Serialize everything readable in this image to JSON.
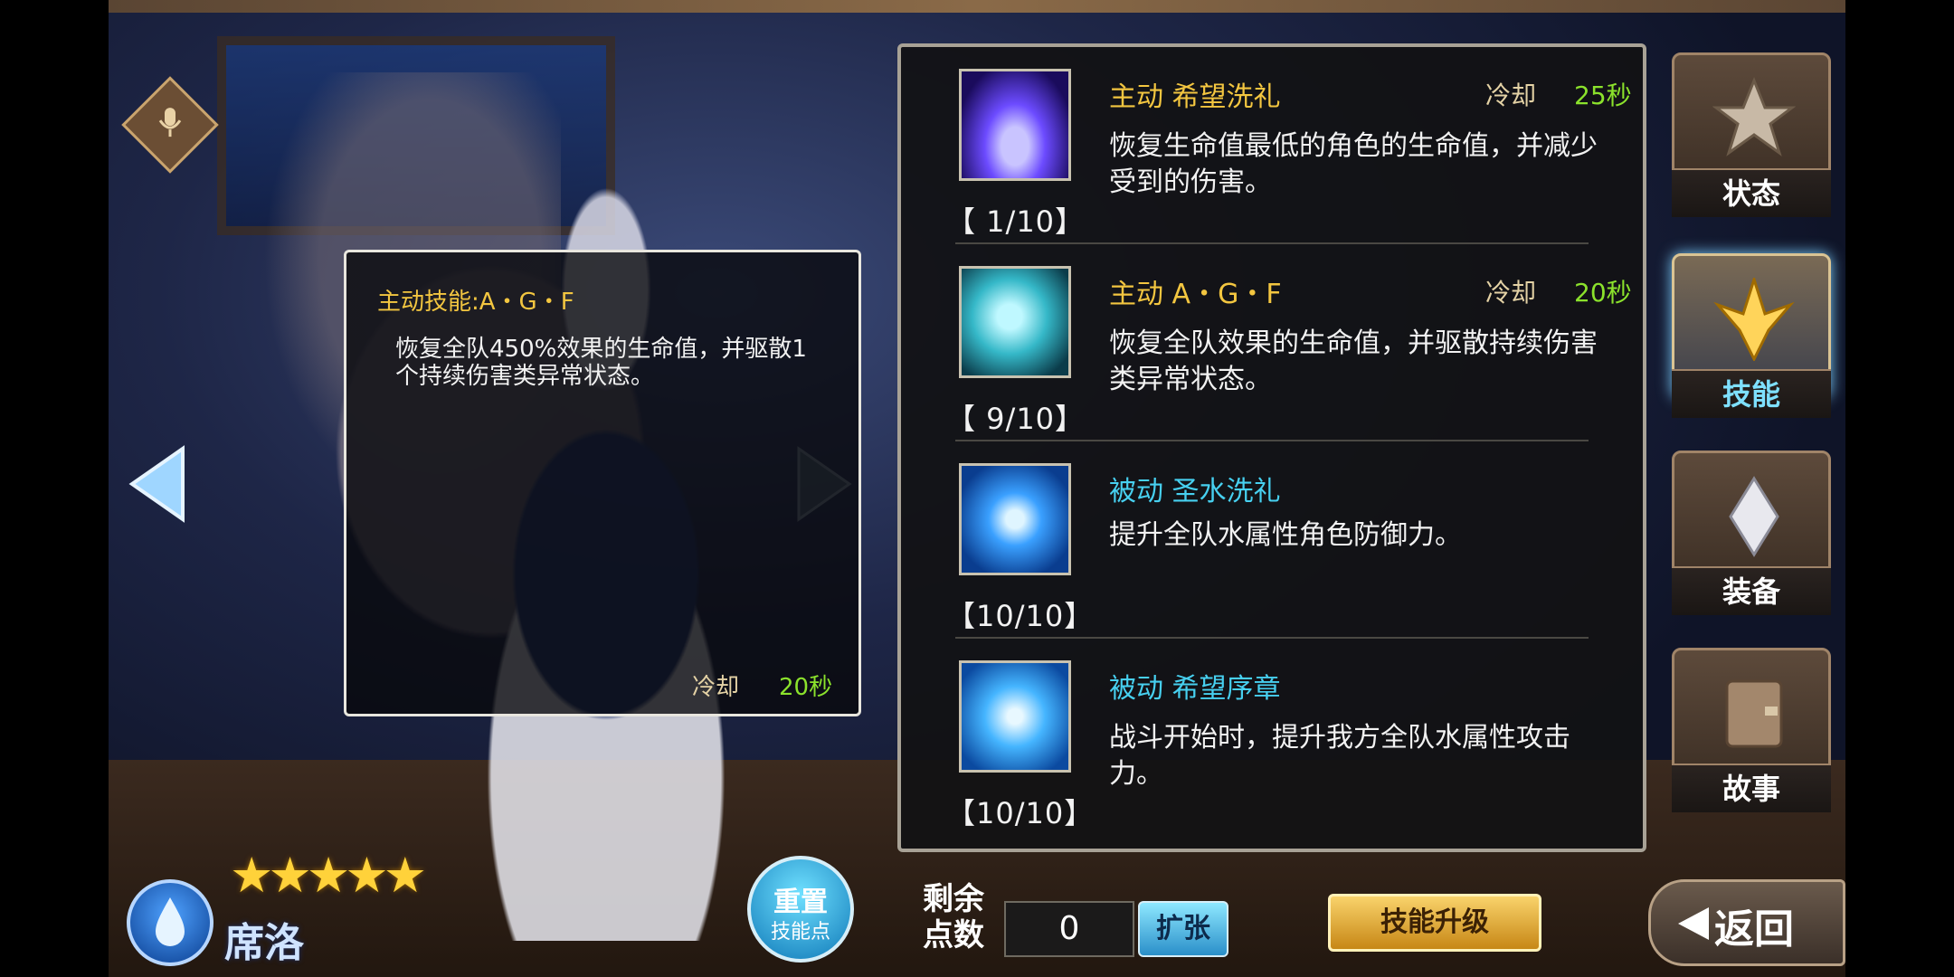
{
  "tooltip": {
    "title": "主动技能:A・G・F",
    "description": "恢复全队450%效果的生命值，并驱散1个持续伤害类异常状态。",
    "cooldown_label": "冷却",
    "cooldown_value": "20秒"
  },
  "skills": [
    {
      "type": "主动",
      "name": "希望洗礼",
      "kind": "active",
      "cooldown_label": "冷却",
      "cooldown_value": "25秒",
      "description": "恢复生命值最低的角色的生命值，并减少受到的伤害。",
      "level": "【  1/10】",
      "icon": "hope-baptism-icon"
    },
    {
      "type": "主动",
      "name": "A・G・F",
      "kind": "active",
      "cooldown_label": "冷却",
      "cooldown_value": "20秒",
      "description": "恢复全队效果的生命值，并驱散持续伤害类异常状态。",
      "level": "【  9/10】",
      "icon": "wings-icon"
    },
    {
      "type": "被动",
      "name": "圣水洗礼",
      "kind": "passive",
      "description": "提升全队水属性角色防御力。",
      "level": "【10/10】",
      "icon": "water-shield-icon"
    },
    {
      "type": "被动",
      "name": "希望序章",
      "kind": "passive",
      "description": "战斗开始时，提升我方全队水属性攻击力。",
      "level": "【10/10】",
      "icon": "water-swirl-icon"
    }
  ],
  "nav": {
    "status": "状态",
    "skills": "技能",
    "equipment": "装备",
    "story": "故事"
  },
  "character": {
    "name": "席洛",
    "stars": 5,
    "element": "water"
  },
  "bottom": {
    "reset_line1": "重置",
    "reset_line2": "技能点",
    "points_label_1": "剩余",
    "points_label_2": "点数",
    "points_value": "0",
    "expand": "扩张",
    "upgrade": "技能升级",
    "back": "返回"
  },
  "colors": {
    "active": "#f3c640",
    "passive": "#47d0f0",
    "cooldown_value": "#8be22c"
  }
}
